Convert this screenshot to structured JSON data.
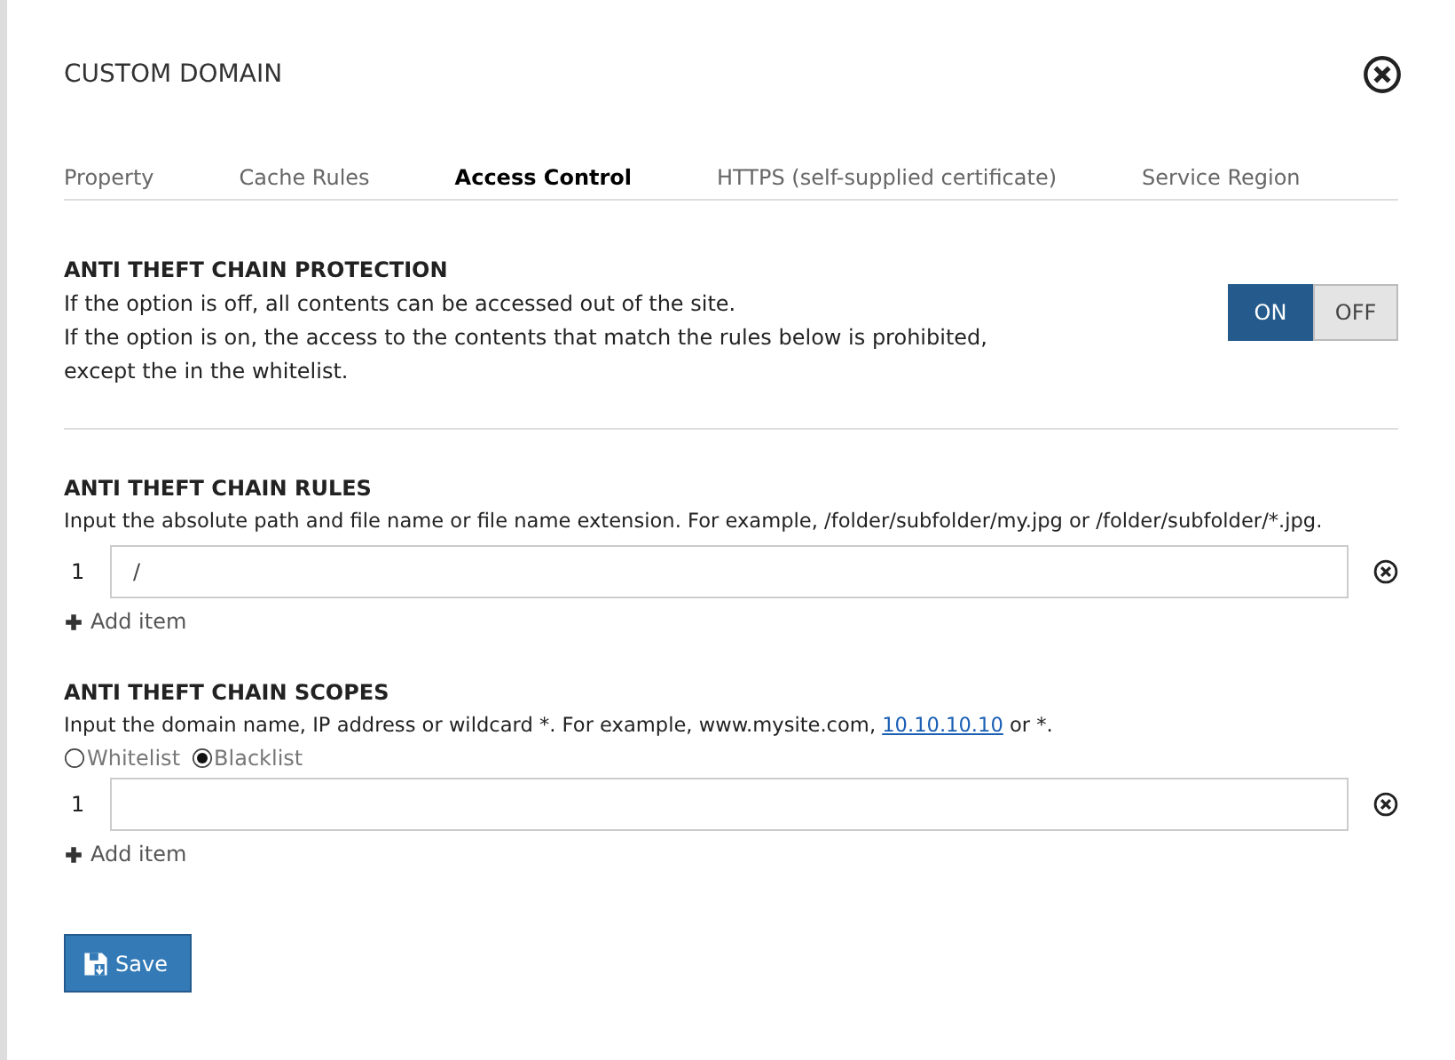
{
  "dialog": {
    "title": "CUSTOM DOMAIN"
  },
  "tabs": [
    {
      "label": "Property",
      "selected": false
    },
    {
      "label": "Cache Rules",
      "selected": false
    },
    {
      "label": "Access Control",
      "selected": true
    },
    {
      "label": "HTTPS (self-supplied certificate)",
      "selected": false
    },
    {
      "label": "Service Region",
      "selected": false
    }
  ],
  "protection": {
    "heading": "ANTI THEFT CHAIN PROTECTION",
    "lines": [
      "If the option is off, all contents can be accessed out of the site.",
      "If the option is on, the access to the contents that match the rules below is prohibited,",
      "except the in the whitelist."
    ],
    "toggle": [
      {
        "label": "ON",
        "selected": true
      },
      {
        "label": "OFF",
        "selected": false
      }
    ]
  },
  "rules": {
    "heading": "ANTI THEFT CHAIN RULES",
    "description": [
      {
        "text": "Input the absolute path and file name or file name extension. For example, /folder/subfolder/my.jpg or /folder/subfolder/*.jpg."
      }
    ],
    "items": [
      {
        "index": "1",
        "value": "/"
      }
    ],
    "add": "Add item"
  },
  "scopes": {
    "heading": "ANTI THEFT CHAIN SCOPES",
    "description": [
      {
        "text": "Input the domain name, IP address or wildcard *. For example, www.mysite.com, "
      },
      {
        "text": "10.10.10.10",
        "kind": "link"
      },
      {
        "text": " or *."
      }
    ],
    "modes": [
      {
        "label": "Whitelist",
        "selected": false
      },
      {
        "label": "Blacklist",
        "selected": true
      }
    ],
    "items": [
      {
        "index": "1",
        "value": ""
      }
    ],
    "add": "Add item"
  },
  "save": "Save"
}
